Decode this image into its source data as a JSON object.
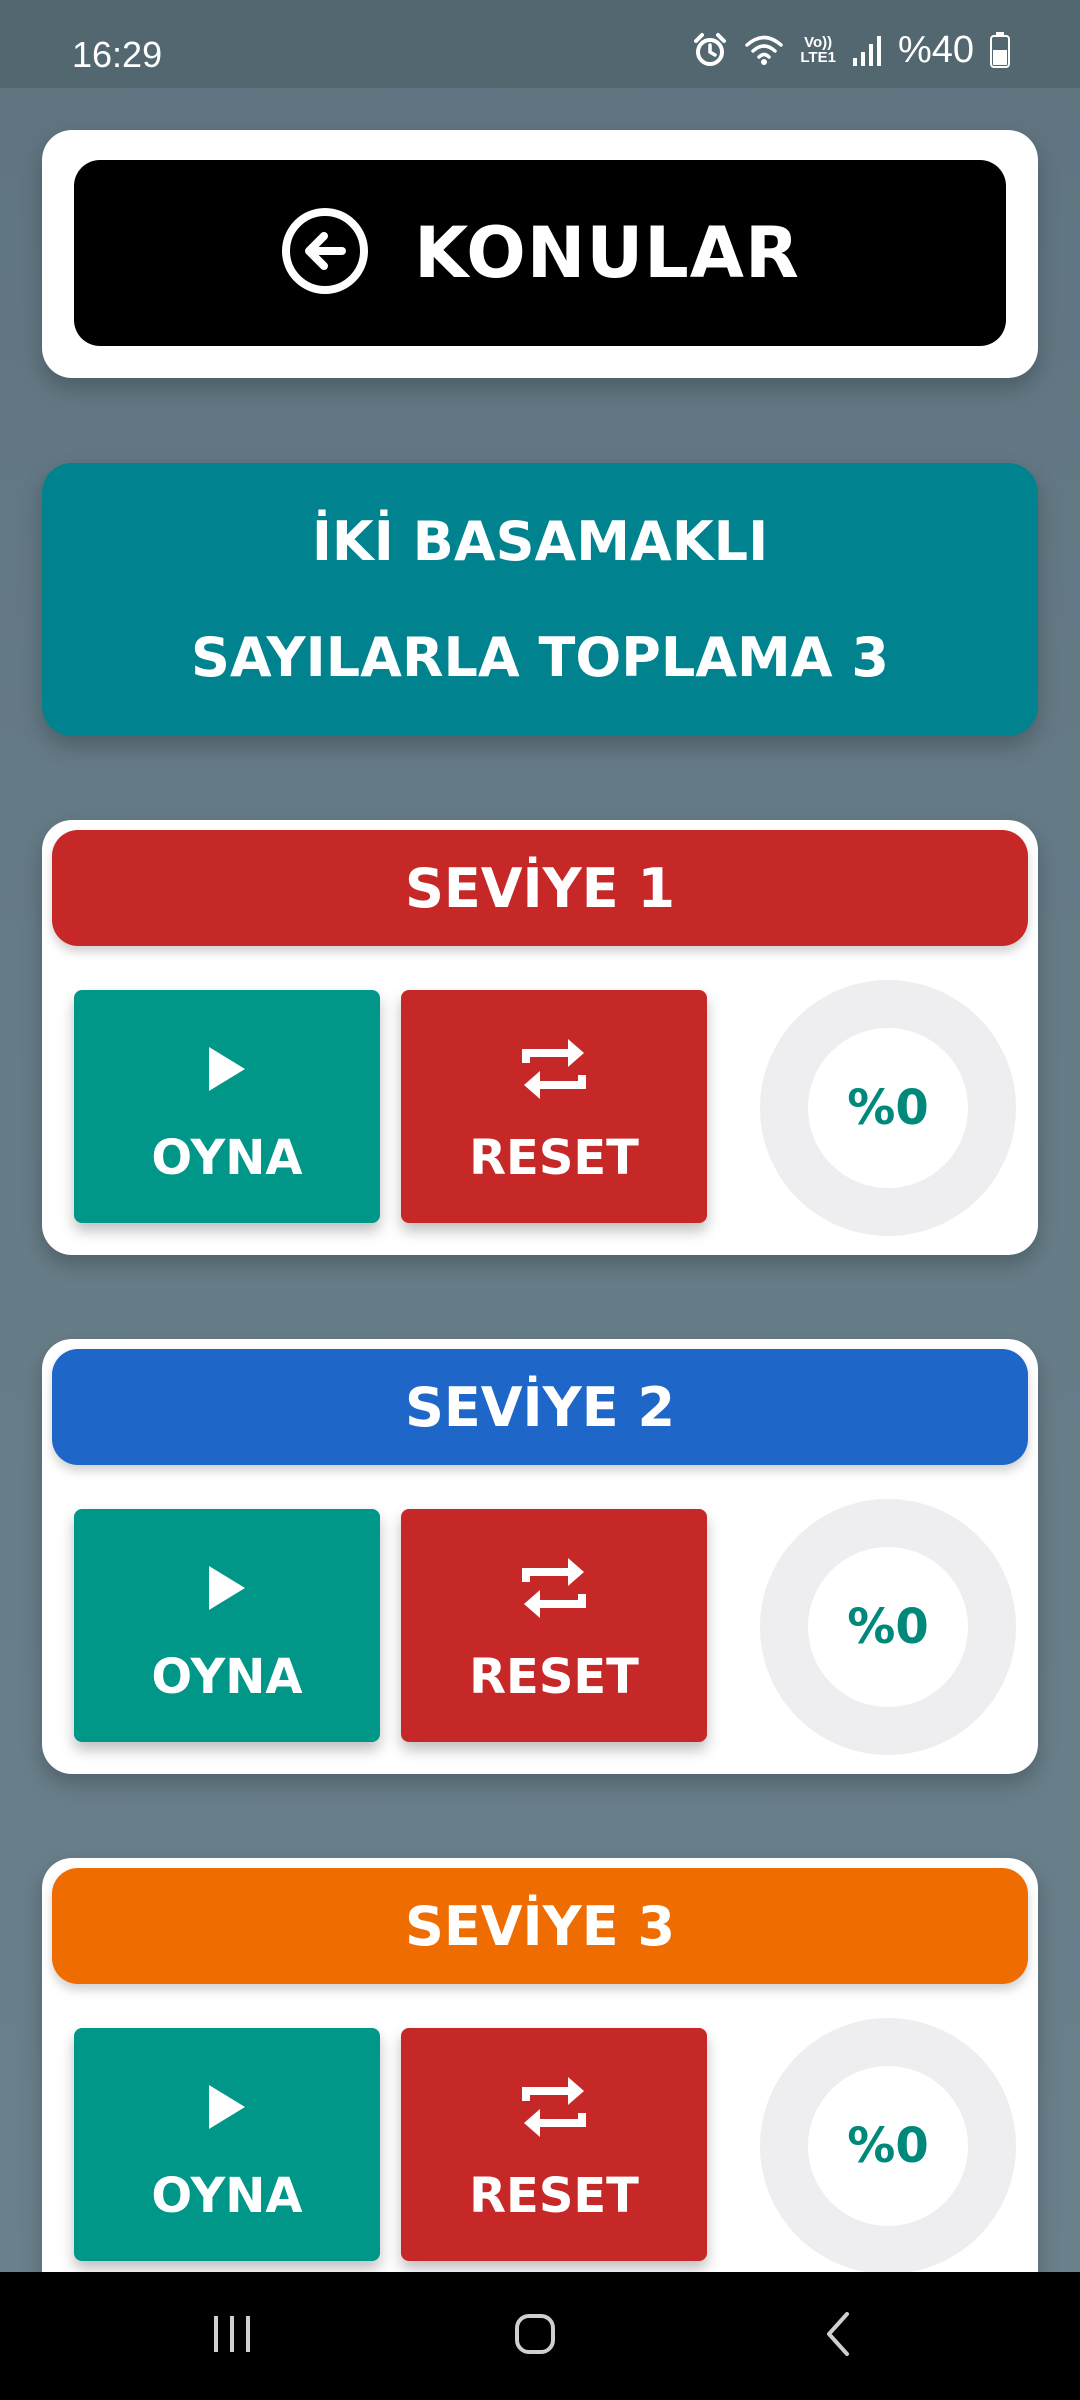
{
  "status_bar": {
    "time": "16:29",
    "icons": [
      "alarm-icon",
      "wifi-icon",
      "volte-icon",
      "signal-icon",
      "battery-icon"
    ],
    "lte_label_top": "Vo))",
    "lte_label_bottom": "LTE1",
    "battery": "%40"
  },
  "header": {
    "back_label": "KONULAR",
    "back_icon": "arrow-left-circle-icon"
  },
  "topic": {
    "line1": "İKİ BASAMAKLI",
    "line2": "SAYILARLA TOPLAMA 3",
    "color": "#00838f"
  },
  "levels": [
    {
      "title": "SEVİYE 1",
      "color": "#c62828",
      "play_label": "OYNA",
      "reset_label": "RESET",
      "progress_text": "%0",
      "progress": 0
    },
    {
      "title": "SEVİYE 2",
      "color": "#1e66c8",
      "play_label": "OYNA",
      "reset_label": "RESET",
      "progress_text": "%0",
      "progress": 0
    },
    {
      "title": "SEVİYE 3",
      "color": "#ef6c00",
      "play_label": "OYNA",
      "reset_label": "RESET",
      "progress_text": "%0",
      "progress": 0
    }
  ],
  "colors": {
    "play": "#009688",
    "reset": "#c62828",
    "progress_track": "#eeeef0",
    "progress_text": "#00897b"
  },
  "nav_bar": {
    "icons": [
      "recent-apps-icon",
      "home-icon",
      "back-icon"
    ]
  }
}
